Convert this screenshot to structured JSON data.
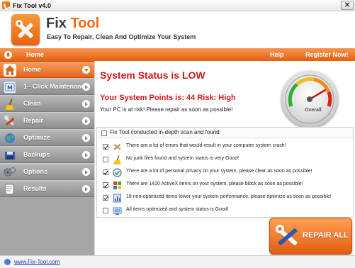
{
  "window": {
    "title": "Fix Tool v4.0",
    "close_glyph": "✕"
  },
  "header": {
    "app_name_main": "Fix ",
    "app_name_accent": "Tool",
    "tagline": "Easy To Repair, Clean And Optimize Your System"
  },
  "navbar": {
    "home": "Home",
    "help": "Help",
    "register": "Register Now!"
  },
  "sidebar": {
    "items": [
      {
        "label": "Home",
        "icon": "home-icon",
        "active": true
      },
      {
        "label": "1 - Click Maintenance",
        "icon": "maintenance-icon",
        "active": false
      },
      {
        "label": "Clean",
        "icon": "broom-icon",
        "active": false
      },
      {
        "label": "Repair",
        "icon": "wrench-icon",
        "active": false
      },
      {
        "label": "Optimize",
        "icon": "globe-icon",
        "active": false
      },
      {
        "label": "Backups",
        "icon": "backup-icon",
        "active": false
      },
      {
        "label": "Options",
        "icon": "options-icon",
        "active": false
      },
      {
        "label": "Results",
        "icon": "results-icon",
        "active": false
      }
    ]
  },
  "main": {
    "status_title": "System Status is LOW",
    "points_line": "Your System Points is: 44  Risk: High",
    "risk_text": "Your PC is at risk! Please repair as soon as possible!",
    "gauge_label": "Overall",
    "scan_header": "Fix Tool conducted in-depth scan and found:",
    "scan_items": [
      {
        "text": "There are a lot of errors that would result in your computer system crash!",
        "checked": true,
        "icon": "wrench-icon"
      },
      {
        "text": "No junk files found and system status is very Good!",
        "checked": false,
        "icon": "broom-icon"
      },
      {
        "text": "There are a lot of personal privacy on your system, please clear as soon as possible!",
        "checked": true,
        "icon": "privacy-icon"
      },
      {
        "text": "There are 1420 ActiveX items on your system, please block as soon as possible!",
        "checked": true,
        "icon": "activex-icon"
      },
      {
        "text": "18 non-optimized items lower your system performance, please optimize as soon as possible!",
        "checked": true,
        "icon": "performance-icon"
      },
      {
        "text": "All items optimized and system status is Good!",
        "checked": false,
        "icon": "optimized-icon"
      }
    ],
    "repair_button": "REPAIR ALL"
  },
  "footer": {
    "link": "www.Fix-Tool.com"
  },
  "colors": {
    "accent": "#e8661a",
    "status_red": "#cc1a1a",
    "link_blue": "#1a3fa8"
  }
}
